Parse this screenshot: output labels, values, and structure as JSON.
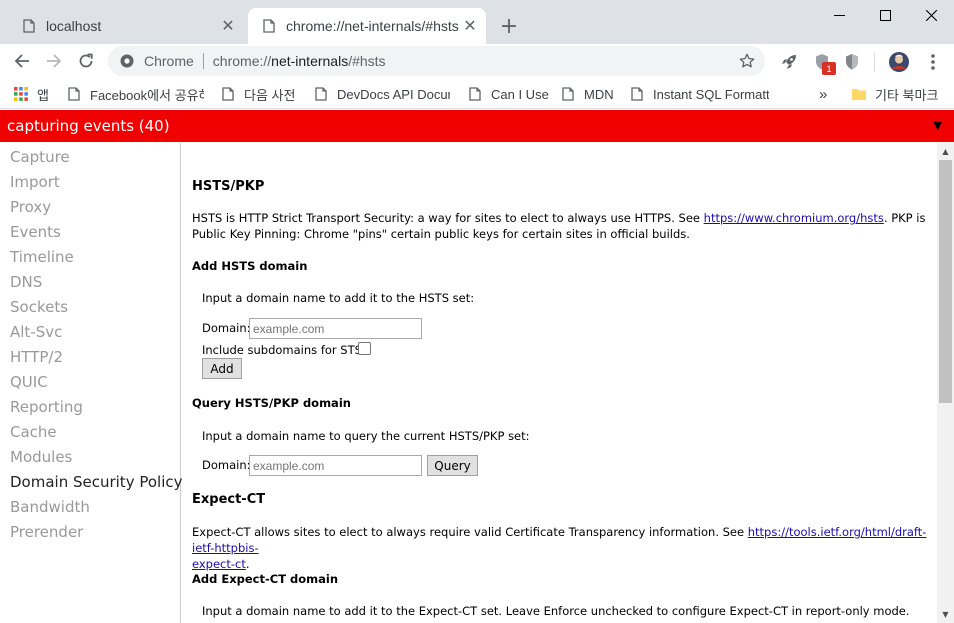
{
  "tabs": [
    {
      "title": "localhost",
      "close": "✕"
    },
    {
      "title": "chrome://net-internals/#hsts",
      "close": "✕"
    }
  ],
  "new_tab": "+",
  "omnibox": {
    "scheme_label": "Chrome",
    "url_prefix": "chrome://",
    "url_host": "net-internals",
    "url_path": "/#hsts"
  },
  "extensions": {
    "badge_count": "1"
  },
  "bookmarks": [
    {
      "label": "앱",
      "icon": "apps-grid-icon"
    },
    {
      "label": "Facebook에서 공유하",
      "icon": "page-icon"
    },
    {
      "label": "다음 사전",
      "icon": "page-icon"
    },
    {
      "label": "DevDocs API Docum",
      "icon": "page-icon"
    },
    {
      "label": "Can I Use",
      "icon": "page-icon"
    },
    {
      "label": "MDN",
      "icon": "page-icon"
    },
    {
      "label": "Instant SQL Formatte",
      "icon": "page-icon"
    },
    {
      "label": "기타 북마크",
      "icon": "folder-icon"
    }
  ],
  "bookmarks_overflow": "»",
  "capture_bar": {
    "status": "capturing events (40)",
    "dropdown": "▼"
  },
  "sidebar": {
    "items": [
      "Capture",
      "Import",
      "Proxy",
      "Events",
      "Timeline",
      "DNS",
      "Sockets",
      "Alt-Svc",
      "HTTP/2",
      "QUIC",
      "Reporting",
      "Cache",
      "Modules",
      "Domain Security Policy",
      "Bandwidth",
      "Prerender"
    ],
    "selected": "Domain Security Policy"
  },
  "content": {
    "hsts_title": "HSTS/PKP",
    "hsts_desc_1": "HSTS is HTTP Strict Transport Security: a way for sites to elect to always use HTTPS. See ",
    "hsts_link": "https://www.chromium.org/hsts",
    "hsts_desc_2": ". PKP is Public Key Pinning: Chrome \"pins\" certain public keys for certain sites in official builds.",
    "add_hsts": {
      "title": "Add HSTS domain",
      "instruction": "Input a domain name to add it to the HSTS set:",
      "domain_label": "Domain:",
      "placeholder": "example.com",
      "subdomains_label": "Include subdomains for STS:",
      "button": "Add"
    },
    "query_hsts": {
      "title": "Query HSTS/PKP domain",
      "instruction": "Input a domain name to query the current HSTS/PKP set:",
      "domain_label": "Domain:",
      "placeholder": "example.com",
      "button": "Query"
    },
    "expect_ct_title": "Expect-CT",
    "expect_ct_desc": "Expect-CT allows sites to elect to always require valid Certificate Transparency information. See ",
    "expect_ct_link_1": "https://tools.ietf.org/html/draft-ietf-httpbis-",
    "expect_ct_link_2": "expect-ct",
    "expect_ct_desc_end": ".",
    "add_expect_ct": {
      "title": "Add Expect-CT domain",
      "instruction": "Input a domain name to add it to the Expect-CT set. Leave Enforce unchecked to configure Expect-CT in report-only mode."
    }
  },
  "colors": {
    "capture_bar": "#f00000",
    "link": "#1a0dab",
    "sidebar_inactive": "#999999"
  }
}
